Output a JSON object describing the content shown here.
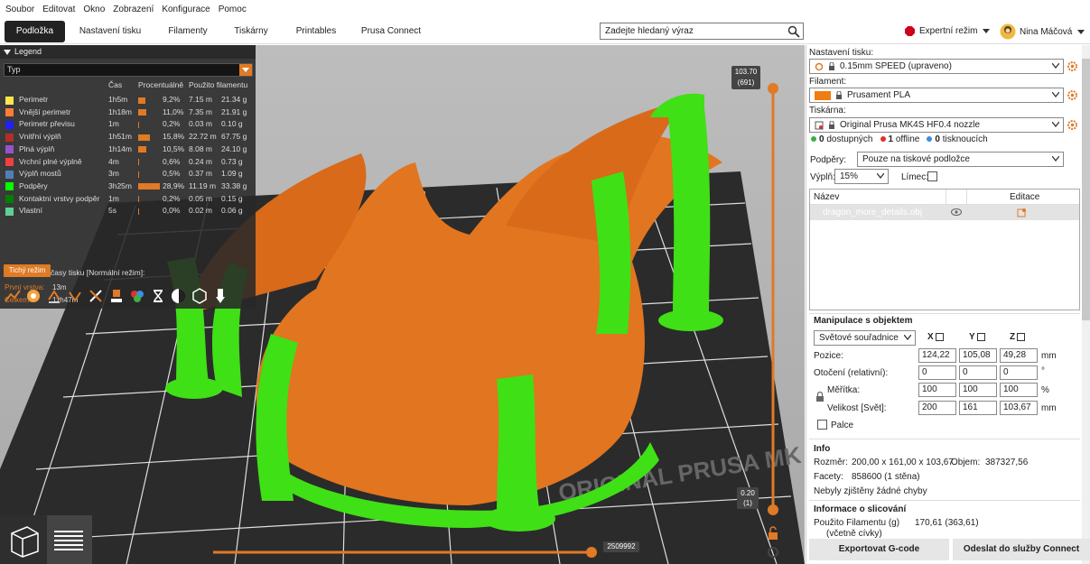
{
  "menu": [
    "Soubor",
    "Editovat",
    "Okno",
    "Zobrazení",
    "Konfigurace",
    "Pomoc"
  ],
  "tabs": [
    "Podložka",
    "Nastavení tisku",
    "Filamenty",
    "Tiskárny",
    "Printables",
    "Prusa Connect"
  ],
  "search": {
    "placeholder": "Zadejte hledaný výraz"
  },
  "mode": {
    "label": "Expertní režim",
    "color": "#d0021b"
  },
  "user": {
    "name": "Nina Máčová"
  },
  "legend": {
    "title": "Legend",
    "type_label": "Typ",
    "headers": {
      "time": "Čas",
      "percent": "Procentuálně",
      "filament": "Použito filamentu"
    },
    "rows": [
      {
        "name": "Perimetr",
        "color": "#ffe64d",
        "time": "1h5m",
        "pct": "9,2%",
        "pct_value": 9.2,
        "len": "7.15 m",
        "weight": "21.34 g"
      },
      {
        "name": "Vnější perimetr",
        "color": "#ff7d38",
        "time": "1h18m",
        "pct": "11,0%",
        "pct_value": 11.0,
        "len": "7.35 m",
        "weight": "21.91 g"
      },
      {
        "name": "Perimetr převisu",
        "color": "#1f1fff",
        "time": "1m",
        "pct": "0,2%",
        "pct_value": 0.2,
        "len": "0.03 m",
        "weight": "0.10 g"
      },
      {
        "name": "Vnitřní výplň",
        "color": "#b03029",
        "time": "1h51m",
        "pct": "15,8%",
        "pct_value": 15.8,
        "len": "22.72 m",
        "weight": "67.75 g"
      },
      {
        "name": "Plná výplň",
        "color": "#9654cc",
        "time": "1h14m",
        "pct": "10,5%",
        "pct_value": 10.5,
        "len": "8.08 m",
        "weight": "24.10 g"
      },
      {
        "name": "Vrchní plné výplně",
        "color": "#f04040",
        "time": "4m",
        "pct": "0,6%",
        "pct_value": 0.6,
        "len": "0.24 m",
        "weight": "0.73 g"
      },
      {
        "name": "Výplň mostů",
        "color": "#4d80ba",
        "time": "3m",
        "pct": "0,5%",
        "pct_value": 0.5,
        "len": "0.37 m",
        "weight": "1.09 g"
      },
      {
        "name": "Podpěry",
        "color": "#00ff00",
        "time": "3h25m",
        "pct": "28,9%",
        "pct_value": 28.9,
        "len": "11.19 m",
        "weight": "33.38 g"
      },
      {
        "name": "Kontaktní vrstvy podpěr",
        "color": "#008000",
        "time": "1m",
        "pct": "0,2%",
        "pct_value": 0.2,
        "len": "0.05 m",
        "weight": "0.15 g"
      },
      {
        "name": "Vlastní",
        "color": "#5ed194",
        "time": "5s",
        "pct": "0,0%",
        "pct_value": 0.0,
        "len": "0.02 m",
        "weight": "0.06 g"
      }
    ],
    "est_title": "Odhadované časy tisku [Normální režim]:",
    "first_layer_label": "První vrstva:",
    "first_layer_value": "13m",
    "total_label": "Celkem:",
    "total_value": "11h47m",
    "quiet_button": "Tichý režim"
  },
  "sliders": {
    "top_height": "103.70",
    "top_layer": "(691)",
    "bottom_height": "0.20",
    "bottom_layer": "(1)",
    "horizontal_value": "2509992"
  },
  "panel": {
    "print_settings_label": "Nastavení tisku:",
    "print_settings_value": "0.15mm SPEED (upraveno)",
    "filament_label": "Filament:",
    "filament_value": "Prusament PLA",
    "filament_color": "#f07d10",
    "printer_label": "Tiskárna:",
    "printer_value": "Original Prusa MK4S HF0.4 nozzle",
    "status": [
      {
        "count": "0",
        "label": "dostupných",
        "color": "#3cb043"
      },
      {
        "count": "1",
        "label": "offline",
        "color": "#e03030"
      },
      {
        "count": "0",
        "label": "tisknoucích",
        "color": "#3a8fe0"
      }
    ],
    "supports_label": "Podpěry:",
    "supports_value": "Pouze na tiskové podložce",
    "infill_label": "Výplň:",
    "infill_value": "15%",
    "brim_label": "Límec:",
    "list_header_name": "Název",
    "list_header_edit": "Editace",
    "object_name": "dragon_more_details.obj",
    "manip_title": "Manipulace s objektem",
    "coord_value": "Světové souřadnice",
    "axes": [
      "X",
      "Y",
      "Z"
    ],
    "position_label": "Pozice:",
    "position": [
      "124,22",
      "105,08",
      "49,28"
    ],
    "position_unit": "mm",
    "rotation_label": "Otočení (relativní):",
    "rotation": [
      "0",
      "0",
      "0"
    ],
    "rotation_unit": "°",
    "scale_label": "Měřítka:",
    "scale": [
      "100",
      "100",
      "100"
    ],
    "scale_unit": "%",
    "size_label": "Velikost [Svět]:",
    "size": [
      "200",
      "161",
      "103,67"
    ],
    "size_unit": "mm",
    "inches_label": "Palce",
    "info_title": "Info",
    "size_info_label": "Rozměr:",
    "size_info_value": "200,00 x 161,00 x 103,67",
    "volume_label": "Objem:",
    "volume_value": "387327,56",
    "facets_label": "Facety:",
    "facets_value": "858600 (1 stěna)",
    "errors_text": "Nebyly zjištěny žádné chyby",
    "slicing_title": "Informace o slicování",
    "filament_used_label": "Použito Filamentu (g)",
    "filament_used_sub": "(včetně cívky)",
    "filament_used_value": "170,61 (363,61)",
    "export_button": "Exportovat G-code",
    "connect_button": "Odeslat do služby Connect"
  }
}
